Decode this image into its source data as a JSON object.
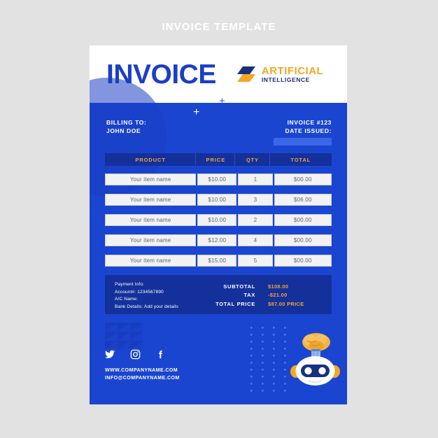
{
  "page": {
    "title": "INVOICE TEMPLATE",
    "background_color": "#e2e2e2",
    "title_color": "#ffffff"
  },
  "theme": {
    "brand_blue": "#1a45d0",
    "deep_navy": "#14309b",
    "accent_orange": "#f0a33a",
    "logo_orange": "#f5a623",
    "logo_navy": "#19307a",
    "card_white": "#ffffff",
    "cell_bg": "#f2f2f2",
    "cell_text": "#5a6374"
  },
  "header": {
    "invoice_word": "INVOICE",
    "plus_mark": "+",
    "logo": {
      "line1": "ARTIFICIAL",
      "line2": "INTELLIGENCE"
    }
  },
  "billing": {
    "plus_mark": "+",
    "billing_to_label": "BILLING TO:",
    "client_name": "JOHN DOE",
    "invoice_number": "INVOICE #123",
    "date_issued_label": "DATE ISSUED:",
    "date_issued_value": ""
  },
  "table": {
    "columns": [
      "PRODUCT",
      "PRICE",
      "QTY",
      "TOTAL"
    ],
    "rows": [
      {
        "product": "Your item name",
        "price": "$10.00",
        "qty": "1",
        "total": "$00.00"
      },
      {
        "product": "Your item name",
        "price": "$10.00",
        "qty": "3",
        "total": "$06.00"
      },
      {
        "product": "Your item name",
        "price": "$10.00",
        "qty": "2",
        "total": "$00.00"
      },
      {
        "product": "Your item name",
        "price": "$12.00",
        "qty": "4",
        "total": "$00.00"
      },
      {
        "product": "Your item name",
        "price": "$15.00",
        "qty": "5",
        "total": "$00.00"
      }
    ]
  },
  "payment": {
    "info_label": "Payment Info:",
    "account": "Account#: 1234567890",
    "ac_name": "A/C Name:",
    "bank_details": "Bank Details: Add your details",
    "totals": [
      {
        "label": "SUBTOTAL",
        "value": "$108.00"
      },
      {
        "label": "TAX",
        "value": "-$21.00"
      },
      {
        "label": "TOTAL PRICE",
        "value": "$87.00 PRICE"
      }
    ]
  },
  "footer": {
    "socials": [
      "twitter-icon",
      "instagram-icon",
      "facebook-icon"
    ],
    "website": "WWW.COMPANYNAME.COM",
    "email": "INFO@COMPANYNAME.COM",
    "decor": {
      "triangle_grid": "triangle-pattern",
      "dot_grid": "dot-pattern",
      "mascot": "robot-icon"
    }
  }
}
